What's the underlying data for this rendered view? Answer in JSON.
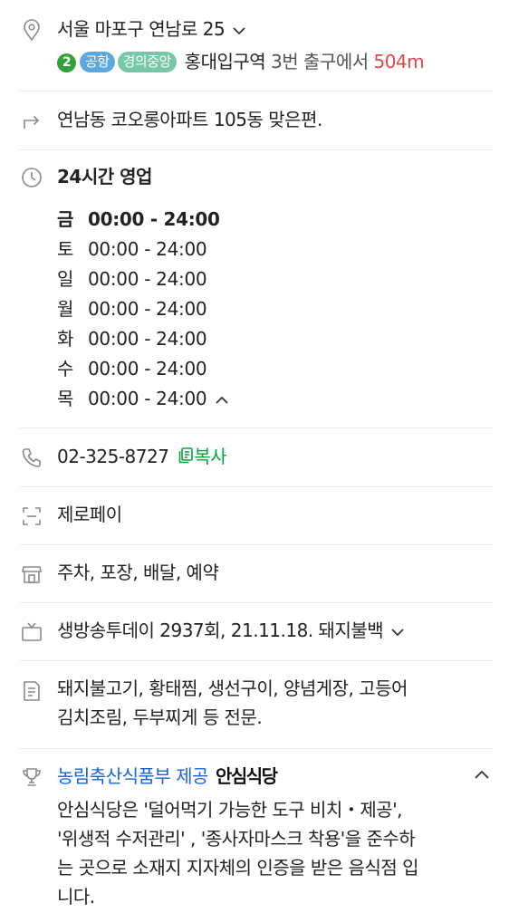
{
  "address": {
    "text": "서울 마포구 연남로 25",
    "line_number": "2",
    "badges": [
      "공항",
      "경의중앙"
    ],
    "station": "홍대입구역",
    "exit_text": "3번 출구에서",
    "distance": "504m"
  },
  "directions": {
    "text": "연남동 코오롱아파트 105동 맞은편."
  },
  "hours": {
    "status": "24시간 영업",
    "days": [
      {
        "day": "금",
        "time": "00:00 - 24:00"
      },
      {
        "day": "토",
        "time": "00:00 - 24:00"
      },
      {
        "day": "일",
        "time": "00:00 - 24:00"
      },
      {
        "day": "월",
        "time": "00:00 - 24:00"
      },
      {
        "day": "화",
        "time": "00:00 - 24:00"
      },
      {
        "day": "수",
        "time": "00:00 - 24:00"
      },
      {
        "day": "목",
        "time": "00:00 - 24:00"
      }
    ]
  },
  "phone": {
    "number": "02-325-8727",
    "copy_label": "복사"
  },
  "zeropay": {
    "text": "제로페이"
  },
  "facilities": {
    "text": "주차, 포장, 배달, 예약"
  },
  "tv": {
    "text": "생방송투데이 2937회, 21.11.18. 돼지불백"
  },
  "description": {
    "line1": "돼지불고기, 황태찜, 생선구이, 양념게장, 고등어",
    "line2": "김치조림, 두부찌게 등 전문."
  },
  "certification": {
    "provider": "농림축산식품부 제공",
    "logo_text": "안심식당",
    "lines": [
      "안심식당은 '덜어먹기 가능한 도구 비치・제공',",
      "'위생적 수저관리' , '종사자마스크 착용'을 준수하",
      "는 곳으로 소재지 지자체의 인증을 받은 음식점 입",
      "니다."
    ]
  },
  "colors": {
    "line2_green": "#33a23d",
    "airport_blue": "#5ea8e0",
    "gyeongui_teal": "#76c7a6",
    "distance_red": "#e5454a",
    "copy_green": "#03a43a",
    "provider_blue": "#1a62d6"
  },
  "icons": [
    "location-pin-icon",
    "turn-arrow-icon",
    "clock-icon",
    "phone-icon",
    "scan-icon",
    "store-icon",
    "tv-icon",
    "document-icon",
    "trophy-icon",
    "chevron-down-icon",
    "chevron-up-icon",
    "copy-icon"
  ]
}
